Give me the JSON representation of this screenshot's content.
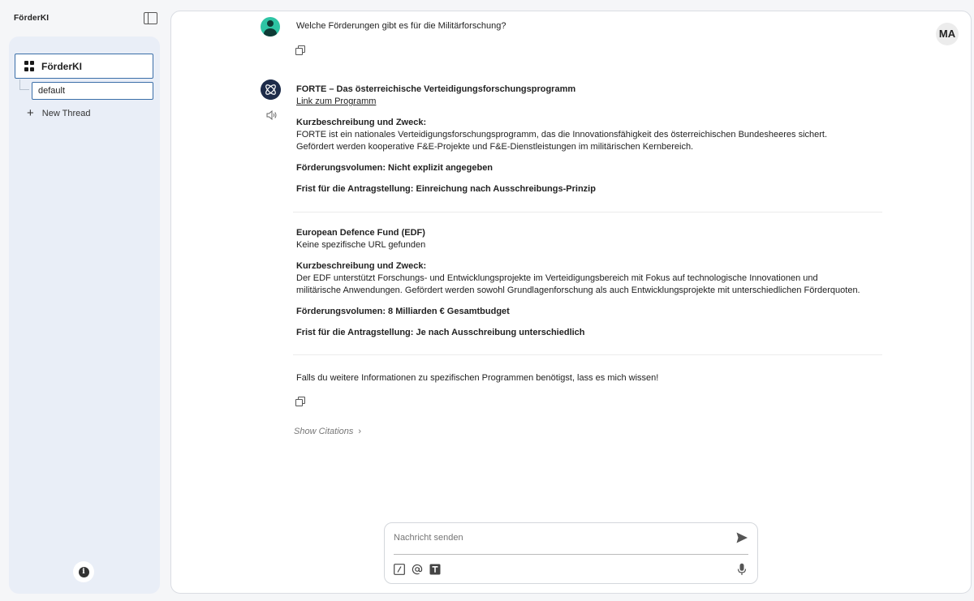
{
  "app": {
    "title": "FörderKI"
  },
  "sidebar": {
    "workspace_label": "FörderKI",
    "thread_value": "default",
    "new_thread_label": "New Thread",
    "info_label": "i"
  },
  "header": {
    "user_initials": "MA"
  },
  "conversation": {
    "user_question": "Welche Förderungen gibt es für die Militärforschung?",
    "programs": [
      {
        "title": "FORTE – Das österreichische Verteidigungsforschungsprogramm",
        "link_text": "Link zum Programm",
        "description_heading": "Kurzbeschreibung und Zweck:",
        "description": "FORTE ist ein nationales Verteidigungsforschungsprogramm, das die Innovationsfähigkeit des österreichischen Bundesheeres sichert. Gefördert werden kooperative F&E-Projekte und F&E-Dienstleistungen im militärischen Kernbereich.",
        "volume": "Förderungsvolumen: Nicht explizit angegeben",
        "deadline": "Frist für die Antragstellung: Einreichung nach Ausschreibungs-Prinzip"
      },
      {
        "title": "European Defence Fund (EDF)",
        "link_text": "Keine spezifische URL gefunden",
        "description_heading": "Kurzbeschreibung und Zweck:",
        "description": "Der EDF unterstützt Forschungs- und Entwicklungsprojekte im Verteidigungsbereich mit Fokus auf technologische Innovationen und militärische Anwendungen. Gefördert werden sowohl Grundlagenforschung als auch Entwicklungsprojekte mit unterschiedlichen Förderquoten.",
        "volume": "Förderungsvolumen: 8 Milliarden € Gesamtbudget",
        "deadline": "Frist für die Antragstellung: Je nach Ausschreibung unterschiedlich"
      }
    ],
    "closing": "Falls du weitere Informationen zu spezifischen Programmen benötigst, lass es mich wissen!",
    "show_citations": "Show Citations"
  },
  "composer": {
    "placeholder": "Nachricht senden"
  },
  "colors": {
    "accent": "#3a6ea8",
    "user_avatar": "#2ec4a4",
    "bot_avatar": "#1e2c4a"
  }
}
